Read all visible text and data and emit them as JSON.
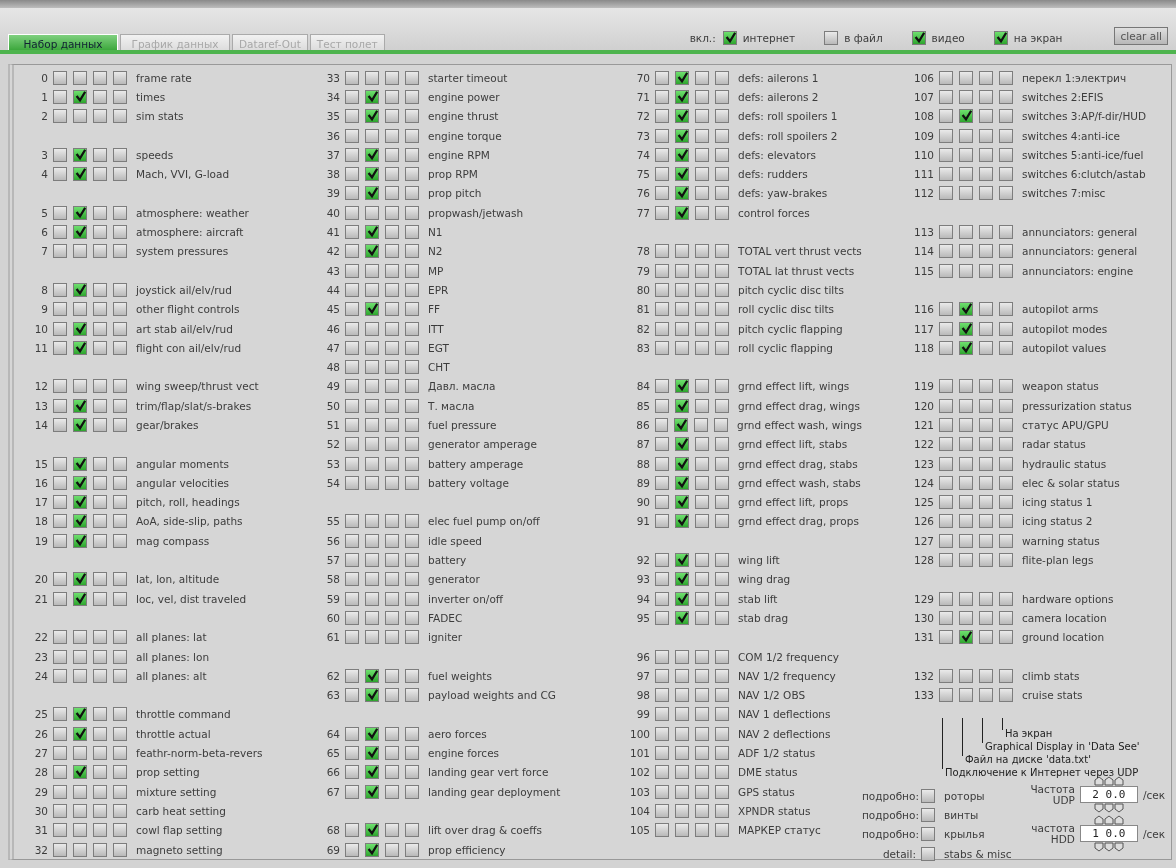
{
  "tabs": [
    {
      "label": "Набор данных",
      "selected": true
    },
    {
      "label": "График данных",
      "selected": false
    },
    {
      "label": "Dataref-Out",
      "selected": false
    },
    {
      "label": "Тест полет",
      "selected": false
    }
  ],
  "outputs": {
    "label": "вкл.:",
    "options": [
      {
        "label": "интернет",
        "checked": true
      },
      {
        "label": "в файл",
        "checked": false
      },
      {
        "label": "видео",
        "checked": true
      },
      {
        "label": "на экран",
        "checked": true
      }
    ]
  },
  "clear_button": "clear all",
  "columns": [
    {
      "groups": [
        [
          {
            "id": "0",
            "label": "frame rate",
            "checked": [
              false,
              false,
              false,
              false
            ]
          },
          {
            "id": "1",
            "label": "times",
            "checked": [
              false,
              true,
              false,
              false
            ]
          },
          {
            "id": "2",
            "label": "sim stats",
            "checked": [
              false,
              false,
              false,
              false
            ]
          }
        ],
        [
          {
            "id": "3",
            "label": "speeds",
            "checked": [
              false,
              true,
              false,
              false
            ]
          },
          {
            "id": "4",
            "label": "Mach, VVI, G-load",
            "checked": [
              false,
              true,
              false,
              false
            ]
          }
        ],
        [
          {
            "id": "5",
            "label": "atmosphere: weather",
            "checked": [
              false,
              true,
              false,
              false
            ]
          },
          {
            "id": "6",
            "label": "atmosphere: aircraft",
            "checked": [
              false,
              true,
              false,
              false
            ]
          },
          {
            "id": "7",
            "label": "system pressures",
            "checked": [
              false,
              false,
              false,
              false
            ]
          }
        ],
        [
          {
            "id": "8",
            "label": "joystick ail/elv/rud",
            "checked": [
              false,
              true,
              false,
              false
            ]
          },
          {
            "id": "9",
            "label": "other flight controls",
            "checked": [
              false,
              false,
              false,
              false
            ]
          },
          {
            "id": "10",
            "label": "art stab ail/elv/rud",
            "checked": [
              false,
              true,
              false,
              false
            ]
          },
          {
            "id": "11",
            "label": "flight con ail/elv/rud",
            "checked": [
              false,
              true,
              false,
              false
            ]
          }
        ],
        [
          {
            "id": "12",
            "label": "wing sweep/thrust vect",
            "checked": [
              false,
              false,
              false,
              false
            ]
          },
          {
            "id": "13",
            "label": "trim/flap/slat/s-brakes",
            "checked": [
              false,
              true,
              false,
              false
            ]
          },
          {
            "id": "14",
            "label": "gear/brakes",
            "checked": [
              false,
              true,
              false,
              false
            ]
          }
        ],
        [
          {
            "id": "15",
            "label": "angular moments",
            "checked": [
              false,
              true,
              false,
              false
            ]
          },
          {
            "id": "16",
            "label": "angular velocities",
            "checked": [
              false,
              true,
              false,
              false
            ]
          },
          {
            "id": "17",
            "label": "pitch, roll, headings",
            "checked": [
              false,
              true,
              false,
              false
            ]
          },
          {
            "id": "18",
            "label": "AoA, side-slip, paths",
            "checked": [
              false,
              true,
              false,
              false
            ]
          },
          {
            "id": "19",
            "label": "mag compass",
            "checked": [
              false,
              true,
              false,
              false
            ]
          }
        ],
        [
          {
            "id": "20",
            "label": "lat, lon, altitude",
            "checked": [
              false,
              true,
              false,
              false
            ]
          },
          {
            "id": "21",
            "label": "loc, vel, dist traveled",
            "checked": [
              false,
              true,
              false,
              false
            ]
          }
        ],
        [
          {
            "id": "22",
            "label": "all planes: lat",
            "checked": [
              false,
              false,
              false,
              false
            ]
          },
          {
            "id": "23",
            "label": "all planes: lon",
            "checked": [
              false,
              false,
              false,
              false
            ]
          },
          {
            "id": "24",
            "label": "all planes: alt",
            "checked": [
              false,
              false,
              false,
              false
            ]
          }
        ],
        [
          {
            "id": "25",
            "label": "throttle command",
            "checked": [
              false,
              true,
              false,
              false
            ]
          },
          {
            "id": "26",
            "label": "throttle actual",
            "checked": [
              false,
              true,
              false,
              false
            ]
          },
          {
            "id": "27",
            "label": "feathr-norm-beta-revers",
            "checked": [
              false,
              false,
              false,
              false
            ]
          },
          {
            "id": "28",
            "label": "prop setting",
            "checked": [
              false,
              true,
              false,
              false
            ]
          },
          {
            "id": "29",
            "label": "mixture setting",
            "checked": [
              false,
              false,
              false,
              false
            ]
          },
          {
            "id": "30",
            "label": "carb heat setting",
            "checked": [
              false,
              false,
              false,
              false
            ]
          },
          {
            "id": "31",
            "label": "cowl flap setting",
            "checked": [
              false,
              false,
              false,
              false
            ]
          },
          {
            "id": "32",
            "label": "magneto setting",
            "checked": [
              false,
              false,
              false,
              false
            ]
          }
        ]
      ]
    },
    {
      "groups": [
        [
          {
            "id": "33",
            "label": "starter timeout",
            "checked": [
              false,
              false,
              false,
              false
            ]
          },
          {
            "id": "34",
            "label": "engine power",
            "checked": [
              false,
              true,
              false,
              false
            ]
          },
          {
            "id": "35",
            "label": "engine thrust",
            "checked": [
              false,
              true,
              false,
              false
            ]
          },
          {
            "id": "36",
            "label": "engine torque",
            "checked": [
              false,
              false,
              false,
              false
            ]
          },
          {
            "id": "37",
            "label": "engine RPM",
            "checked": [
              false,
              true,
              false,
              false
            ]
          },
          {
            "id": "38",
            "label": "prop RPM",
            "checked": [
              false,
              true,
              false,
              false
            ]
          },
          {
            "id": "39",
            "label": "prop pitch",
            "checked": [
              false,
              true,
              false,
              false
            ]
          },
          {
            "id": "40",
            "label": "propwash/jetwash",
            "checked": [
              false,
              false,
              false,
              false
            ]
          },
          {
            "id": "41",
            "label": "N1",
            "checked": [
              false,
              true,
              false,
              false
            ]
          },
          {
            "id": "42",
            "label": "N2",
            "checked": [
              false,
              true,
              false,
              false
            ]
          },
          {
            "id": "43",
            "label": "MP",
            "checked": [
              false,
              false,
              false,
              false
            ]
          },
          {
            "id": "44",
            "label": "EPR",
            "checked": [
              false,
              false,
              false,
              false
            ]
          },
          {
            "id": "45",
            "label": "FF",
            "checked": [
              false,
              true,
              false,
              false
            ]
          },
          {
            "id": "46",
            "label": "ITT",
            "checked": [
              false,
              false,
              false,
              false
            ]
          },
          {
            "id": "47",
            "label": "EGT",
            "checked": [
              false,
              false,
              false,
              false
            ]
          },
          {
            "id": "48",
            "label": "CHT",
            "checked": [
              false,
              false,
              false,
              false
            ]
          },
          {
            "id": "49",
            "label": "Давл. масла",
            "checked": [
              false,
              false,
              false,
              false
            ]
          },
          {
            "id": "50",
            "label": "Т. масла",
            "checked": [
              false,
              false,
              false,
              false
            ]
          },
          {
            "id": "51",
            "label": "fuel pressure",
            "checked": [
              false,
              false,
              false,
              false
            ]
          },
          {
            "id": "52",
            "label": "generator amperage",
            "checked": [
              false,
              false,
              false,
              false
            ]
          },
          {
            "id": "53",
            "label": "battery amperage",
            "checked": [
              false,
              false,
              false,
              false
            ]
          },
          {
            "id": "54",
            "label": "battery voltage",
            "checked": [
              false,
              false,
              false,
              false
            ]
          }
        ],
        [
          {
            "id": "55",
            "label": "elec fuel pump on/off",
            "checked": [
              false,
              false,
              false,
              false
            ]
          },
          {
            "id": "56",
            "label": "idle speed",
            "checked": [
              false,
              false,
              false,
              false
            ]
          },
          {
            "id": "57",
            "label": "battery",
            "checked": [
              false,
              false,
              false,
              false
            ]
          },
          {
            "id": "58",
            "label": "generator",
            "checked": [
              false,
              false,
              false,
              false
            ]
          },
          {
            "id": "59",
            "label": "inverter on/off",
            "checked": [
              false,
              false,
              false,
              false
            ]
          },
          {
            "id": "60",
            "label": "FADEC",
            "checked": [
              false,
              false,
              false,
              false
            ]
          },
          {
            "id": "61",
            "label": "igniter",
            "checked": [
              false,
              false,
              false,
              false
            ]
          }
        ],
        [
          {
            "id": "62",
            "label": "fuel weights",
            "checked": [
              false,
              true,
              false,
              false
            ]
          },
          {
            "id": "63",
            "label": "payload weights and CG",
            "checked": [
              false,
              true,
              false,
              false
            ]
          }
        ],
        [
          {
            "id": "64",
            "label": "aero forces",
            "checked": [
              false,
              true,
              false,
              false
            ]
          },
          {
            "id": "65",
            "label": "engine forces",
            "checked": [
              false,
              true,
              false,
              false
            ]
          },
          {
            "id": "66",
            "label": "landing gear vert force",
            "checked": [
              false,
              true,
              false,
              false
            ]
          },
          {
            "id": "67",
            "label": "landing gear deployment",
            "checked": [
              false,
              true,
              false,
              false
            ]
          }
        ],
        [
          {
            "id": "68",
            "label": "lift over drag & coeffs",
            "checked": [
              false,
              true,
              false,
              false
            ]
          },
          {
            "id": "69",
            "label": "prop efficiency",
            "checked": [
              false,
              true,
              false,
              false
            ]
          }
        ]
      ]
    },
    {
      "groups": [
        [
          {
            "id": "70",
            "label": "defs: ailerons 1",
            "checked": [
              false,
              true,
              false,
              false
            ]
          },
          {
            "id": "71",
            "label": "defs: ailerons 2",
            "checked": [
              false,
              true,
              false,
              false
            ]
          },
          {
            "id": "72",
            "label": "defs: roll spoilers 1",
            "checked": [
              false,
              true,
              false,
              false
            ]
          },
          {
            "id": "73",
            "label": "defs: roll spoilers 2",
            "checked": [
              false,
              true,
              false,
              false
            ]
          },
          {
            "id": "74",
            "label": "defs: elevators",
            "checked": [
              false,
              true,
              false,
              false
            ]
          },
          {
            "id": "75",
            "label": "defs: rudders",
            "checked": [
              false,
              true,
              false,
              false
            ]
          },
          {
            "id": "76",
            "label": "defs: yaw-brakes",
            "checked": [
              false,
              true,
              false,
              false
            ]
          },
          {
            "id": "77",
            "label": "control forces",
            "checked": [
              false,
              true,
              false,
              false
            ]
          }
        ],
        [
          {
            "id": "78",
            "label": "TOTAL vert thrust vects",
            "checked": [
              false,
              false,
              false,
              false
            ]
          },
          {
            "id": "79",
            "label": "TOTAL lat thrust vects",
            "checked": [
              false,
              false,
              false,
              false
            ]
          },
          {
            "id": "80",
            "label": "pitch cyclic disc tilts",
            "checked": [
              false,
              false,
              false,
              false
            ]
          },
          {
            "id": "81",
            "label": "roll cyclic disc tilts",
            "checked": [
              false,
              false,
              false,
              false
            ]
          },
          {
            "id": "82",
            "label": "pitch cyclic flapping",
            "checked": [
              false,
              false,
              false,
              false
            ]
          },
          {
            "id": "83",
            "label": "roll cyclic flapping",
            "checked": [
              false,
              false,
              false,
              false
            ]
          }
        ],
        [
          {
            "id": "84",
            "label": "grnd effect lift, wings",
            "checked": [
              false,
              true,
              false,
              false
            ]
          },
          {
            "id": "85",
            "label": "grnd effect drag, wings",
            "checked": [
              false,
              true,
              false,
              false
            ]
          },
          {
            "id": "86",
            "label": "grnd effect wash, wings",
            "checked": [
              false,
              true,
              false,
              false
            ]
          },
          {
            "id": "87",
            "label": "grnd effect lift, stabs",
            "checked": [
              false,
              true,
              false,
              false
            ]
          },
          {
            "id": "88",
            "label": "grnd effect drag, stabs",
            "checked": [
              false,
              true,
              false,
              false
            ]
          },
          {
            "id": "89",
            "label": "grnd effect wash, stabs",
            "checked": [
              false,
              true,
              false,
              false
            ]
          },
          {
            "id": "90",
            "label": "grnd effect lift, props",
            "checked": [
              false,
              true,
              false,
              false
            ]
          },
          {
            "id": "91",
            "label": "grnd effect drag, props",
            "checked": [
              false,
              true,
              false,
              false
            ]
          }
        ],
        [
          {
            "id": "92",
            "label": "wing lift",
            "checked": [
              false,
              true,
              false,
              false
            ]
          },
          {
            "id": "93",
            "label": "wing drag",
            "checked": [
              false,
              true,
              false,
              false
            ]
          },
          {
            "id": "94",
            "label": "stab lift",
            "checked": [
              false,
              true,
              false,
              false
            ]
          },
          {
            "id": "95",
            "label": "stab drag",
            "checked": [
              false,
              true,
              false,
              false
            ]
          }
        ],
        [
          {
            "id": "96",
            "label": "COM 1/2 frequency",
            "checked": [
              false,
              false,
              false,
              false
            ]
          },
          {
            "id": "97",
            "label": "NAV 1/2 frequency",
            "checked": [
              false,
              false,
              false,
              false
            ]
          },
          {
            "id": "98",
            "label": "NAV 1/2 OBS",
            "checked": [
              false,
              false,
              false,
              false
            ]
          },
          {
            "id": "99",
            "label": "NAV 1 deflections",
            "checked": [
              false,
              false,
              false,
              false
            ]
          },
          {
            "id": "100",
            "label": "NAV 2 deflections",
            "checked": [
              false,
              false,
              false,
              false
            ]
          },
          {
            "id": "101",
            "label": "ADF 1/2 status",
            "checked": [
              false,
              false,
              false,
              false
            ]
          },
          {
            "id": "102",
            "label": "DME status",
            "checked": [
              false,
              false,
              false,
              false
            ]
          },
          {
            "id": "103",
            "label": "GPS status",
            "checked": [
              false,
              false,
              false,
              false
            ]
          },
          {
            "id": "104",
            "label": "XPNDR status",
            "checked": [
              false,
              false,
              false,
              false
            ]
          },
          {
            "id": "105",
            "label": "МАРКЕР статус",
            "checked": [
              false,
              false,
              false,
              false
            ]
          }
        ]
      ]
    },
    {
      "groups": [
        [
          {
            "id": "106",
            "label": "перекл 1:электрич",
            "checked": [
              false,
              false,
              false,
              false
            ]
          },
          {
            "id": "107",
            "label": "switches 2:EFIS",
            "checked": [
              false,
              false,
              false,
              false
            ]
          },
          {
            "id": "108",
            "label": "switches 3:AP/f-dir/HUD",
            "checked": [
              false,
              true,
              false,
              false
            ]
          },
          {
            "id": "109",
            "label": "switches 4:anti-ice",
            "checked": [
              false,
              false,
              false,
              false
            ]
          },
          {
            "id": "110",
            "label": "switches 5:anti-ice/fuel",
            "checked": [
              false,
              false,
              false,
              false
            ]
          },
          {
            "id": "111",
            "label": "switches 6:clutch/astab",
            "checked": [
              false,
              false,
              false,
              false
            ]
          },
          {
            "id": "112",
            "label": "switches 7:misc",
            "checked": [
              false,
              false,
              false,
              false
            ]
          }
        ],
        [
          {
            "id": "113",
            "label": "annunciators: general",
            "checked": [
              false,
              false,
              false,
              false
            ]
          },
          {
            "id": "114",
            "label": "annunciators: general",
            "checked": [
              false,
              false,
              false,
              false
            ]
          },
          {
            "id": "115",
            "label": "annunciators: engine",
            "checked": [
              false,
              false,
              false,
              false
            ]
          }
        ],
        [
          {
            "id": "116",
            "label": "autopilot arms",
            "checked": [
              false,
              true,
              false,
              false
            ]
          },
          {
            "id": "117",
            "label": "autopilot modes",
            "checked": [
              false,
              true,
              false,
              false
            ]
          },
          {
            "id": "118",
            "label": "autopilot values",
            "checked": [
              false,
              true,
              false,
              false
            ]
          }
        ],
        [
          {
            "id": "119",
            "label": "weapon status",
            "checked": [
              false,
              false,
              false,
              false
            ]
          },
          {
            "id": "120",
            "label": "pressurization status",
            "checked": [
              false,
              false,
              false,
              false
            ]
          },
          {
            "id": "121",
            "label": "статус APU/GPU",
            "checked": [
              false,
              false,
              false,
              false
            ]
          },
          {
            "id": "122",
            "label": "radar status",
            "checked": [
              false,
              false,
              false,
              false
            ]
          },
          {
            "id": "123",
            "label": "hydraulic status",
            "checked": [
              false,
              false,
              false,
              false
            ]
          },
          {
            "id": "124",
            "label": "elec & solar status",
            "checked": [
              false,
              false,
              false,
              false
            ]
          },
          {
            "id": "125",
            "label": "icing status 1",
            "checked": [
              false,
              false,
              false,
              false
            ]
          },
          {
            "id": "126",
            "label": "icing status 2",
            "checked": [
              false,
              false,
              false,
              false
            ]
          },
          {
            "id": "127",
            "label": "warning status",
            "checked": [
              false,
              false,
              false,
              false
            ]
          },
          {
            "id": "128",
            "label": "flite-plan legs",
            "checked": [
              false,
              false,
              false,
              false
            ]
          }
        ],
        [
          {
            "id": "129",
            "label": "hardware options",
            "checked": [
              false,
              false,
              false,
              false
            ]
          },
          {
            "id": "130",
            "label": "camera location",
            "checked": [
              false,
              false,
              false,
              false
            ]
          },
          {
            "id": "131",
            "label": "ground location",
            "checked": [
              false,
              true,
              false,
              false
            ]
          }
        ],
        [
          {
            "id": "132",
            "label": "climb stats",
            "checked": [
              false,
              false,
              false,
              false
            ]
          },
          {
            "id": "133",
            "label": "cruise stats",
            "checked": [
              false,
              false,
              false,
              false
            ]
          }
        ]
      ]
    }
  ],
  "legend": [
    "На экран",
    "Graphical Display in 'Data See'",
    "Файл на диске 'data.txt'",
    "Подключение к Интернет через UDP"
  ],
  "detail_options": [
    {
      "label": "подробно:",
      "option": "роторы",
      "checked": false
    },
    {
      "label": "подробно:",
      "option": "винты",
      "checked": false
    },
    {
      "label": "подробно:",
      "option": "крылья",
      "checked": false
    },
    {
      "label": "detail:",
      "option": "stabs & misc",
      "checked": false
    }
  ],
  "rates": [
    {
      "label": "Частота UDP",
      "value": "2 0.0",
      "unit": "/сек"
    },
    {
      "label": "частота HDD",
      "value": "1 0.0",
      "unit": "/сек"
    }
  ]
}
